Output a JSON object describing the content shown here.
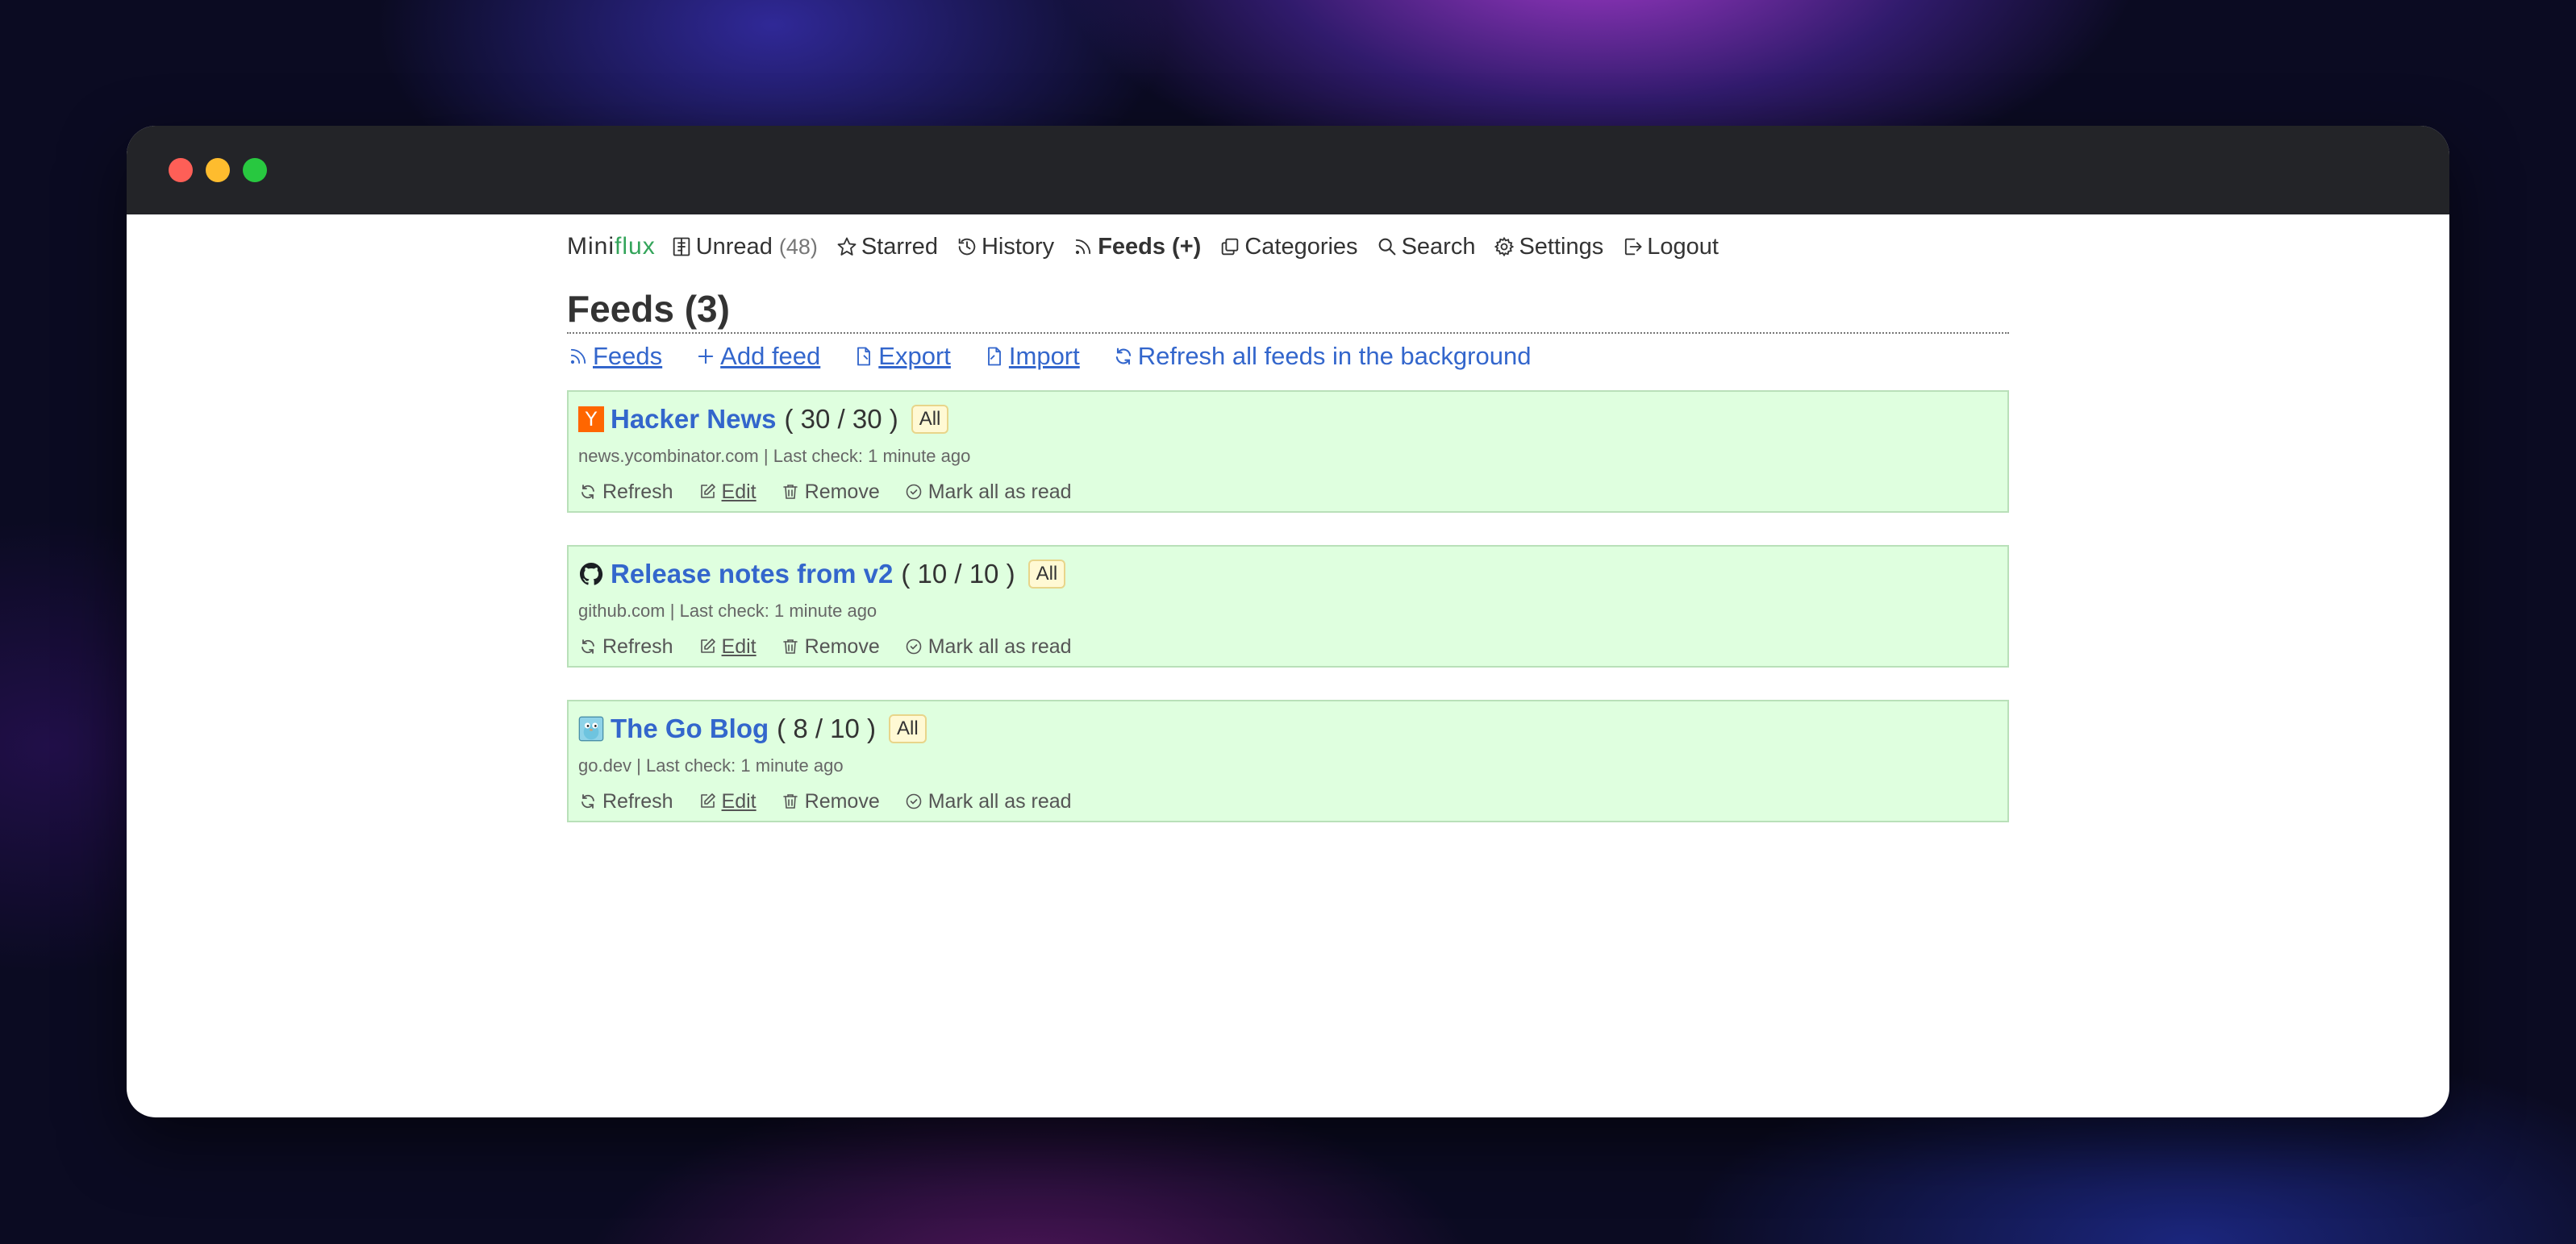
{
  "app": {
    "logo_prefix": "Mini",
    "logo_accent": "flux",
    "accent_color": "#33a45a",
    "link_color": "#3366cc"
  },
  "nav": {
    "unread_label": "Unread",
    "unread_count": "(48)",
    "starred_label": "Starred",
    "history_label": "History",
    "feeds_label": "Feeds (+)",
    "categories_label": "Categories",
    "search_label": "Search",
    "settings_label": "Settings",
    "logout_label": "Logout"
  },
  "page": {
    "title": "Feeds (3)"
  },
  "subnav": {
    "feeds_label": "Feeds",
    "add_feed_label": "Add feed",
    "export_label": "Export",
    "import_label": "Import",
    "refresh_all_label": "Refresh all feeds in the background"
  },
  "feeds": [
    {
      "title": "Hacker News",
      "counts": "( 30 / 30 )",
      "badge": "All",
      "site": "news.ycombinator.com",
      "last_check": "Last check: 1 minute ago",
      "icon": "hacker-news-icon",
      "icon_glyph": "Y",
      "refresh": "Refresh",
      "edit": "Edit",
      "remove": "Remove",
      "mark_all": "Mark all as read"
    },
    {
      "title": "Release notes from v2",
      "counts": "( 10 / 10 )",
      "badge": "All",
      "site": "github.com",
      "last_check": "Last check: 1 minute ago",
      "icon": "github-icon",
      "refresh": "Refresh",
      "edit": "Edit",
      "remove": "Remove",
      "mark_all": "Mark all as read"
    },
    {
      "title": "The Go Blog",
      "counts": "( 8 / 10 )",
      "badge": "All",
      "site": "go.dev",
      "last_check": "Last check: 1 minute ago",
      "icon": "go-gopher-icon",
      "refresh": "Refresh",
      "edit": "Edit",
      "remove": "Remove",
      "mark_all": "Mark all as read"
    }
  ]
}
